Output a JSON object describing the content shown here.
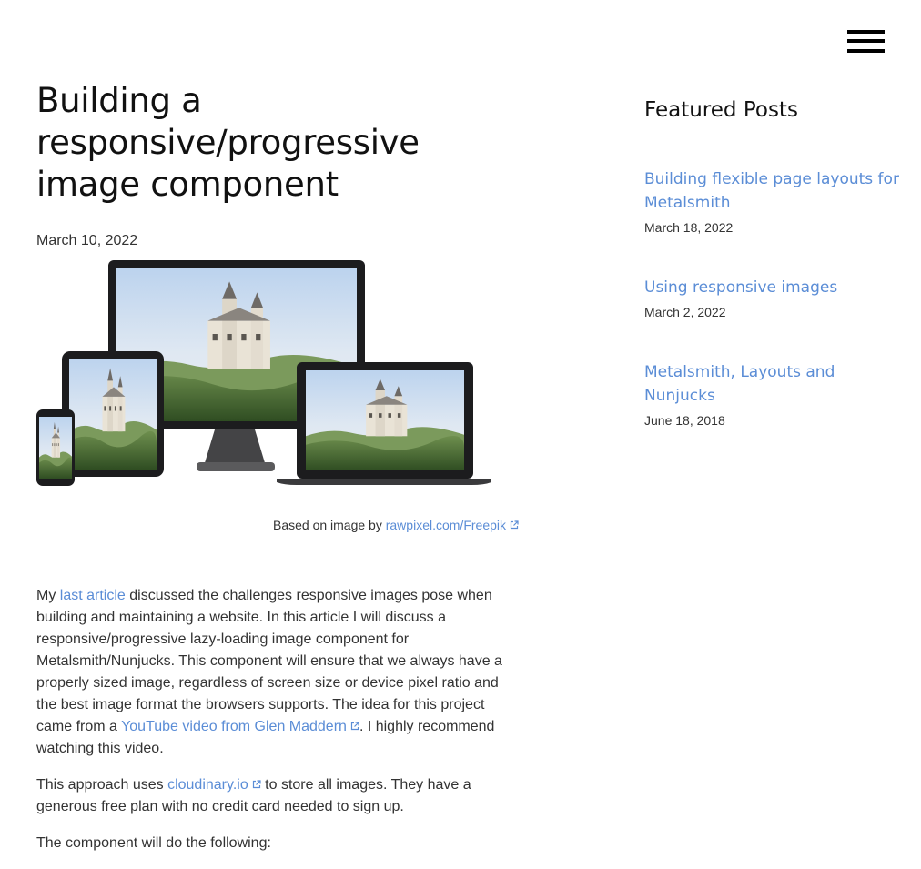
{
  "nav": {
    "menu_icon": "hamburger-menu-icon"
  },
  "article": {
    "title": "Building a responsive/progressive image component",
    "date": "March 10, 2022",
    "caption": {
      "prefix": "Based on image by ",
      "link": "rawpixel.com/Freepik"
    },
    "p1": {
      "t1": "My ",
      "link1": "last article",
      "t2": " discussed the challenges responsive images pose when building and maintaining a website. In this article I will discuss a responsive/progressive lazy-loading image component for Metalsmith/Nunjucks. This component will ensure that we always have a properly sized image, regardless of screen size or device pixel ratio and the best image format the browsers supports. The idea for this project came from a ",
      "link2": "YouTube video from Glen Maddern",
      "t3": ". I highly recommend watching this video."
    },
    "p2": {
      "t1": "This approach uses ",
      "link1": "cloudinary.io",
      "t2": " to store all images. They have a generous free plan with no credit card needed to sign up."
    },
    "p3": {
      "t1": "The component will do the following:"
    }
  },
  "sidebar": {
    "title": "Featured Posts",
    "items": [
      {
        "label": "Building flexible page layouts for Metalsmith",
        "date": "March 18, 2022"
      },
      {
        "label": "Using responsive images",
        "date": "March 2, 2022"
      },
      {
        "label": "Metalsmith, Layouts and Nunjucks",
        "date": "June 18, 2018"
      }
    ]
  },
  "colors": {
    "link": "#5b8dd6",
    "text": "#333333",
    "heading": "#111111"
  }
}
